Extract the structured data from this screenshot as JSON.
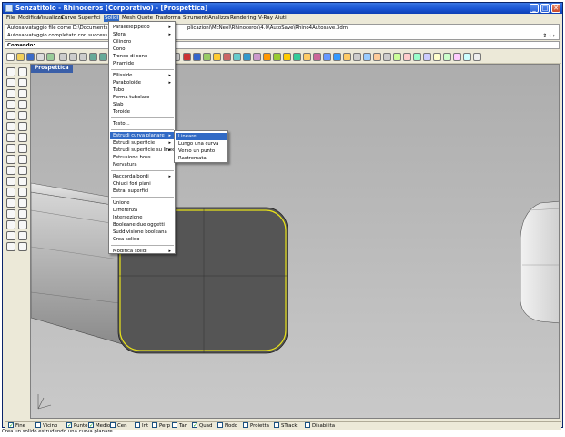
{
  "window": {
    "title": "Senzatitolo - Rhinoceros (Corporativo) - [Prospettica]",
    "controls": [
      "_",
      "□",
      "✕"
    ]
  },
  "menubar": [
    {
      "label": "File",
      "active": false
    },
    {
      "label": "Modifica",
      "active": false
    },
    {
      "label": "Visualizza",
      "active": false
    },
    {
      "label": "Curve",
      "active": false
    },
    {
      "label": "Superfici",
      "active": false
    },
    {
      "label": "Solidi",
      "active": true
    },
    {
      "label": "Mesh",
      "active": false
    },
    {
      "label": "Quote",
      "active": false
    },
    {
      "label": "Trasforma",
      "active": false
    },
    {
      "label": "Strumenti",
      "active": false
    },
    {
      "label": "Analizza",
      "active": false
    },
    {
      "label": "Rendering",
      "active": false
    },
    {
      "label": "V-Ray",
      "active": false
    },
    {
      "label": "Aiuti",
      "active": false
    }
  ],
  "command_history": [
    "Autosalvataggio file come D:\\Documents",
    "Autosalvataggio completato con success"
  ],
  "command_history_tail": "plicazioni\\McNeel\\Rhinoceros\\4.0\\AutoSave\\Rhino4Autosave.3dm",
  "command_prompt_label": "Comando:",
  "viewport_label": "Prospettica",
  "solidi_menu": {
    "items": [
      {
        "label": "Parallelepipedo",
        "submenu": true
      },
      {
        "label": "Sfera",
        "submenu": true
      },
      {
        "label": "Cilindro"
      },
      {
        "label": "Cono"
      },
      {
        "label": "Tronco di cono"
      },
      {
        "label": "Piramide"
      },
      {
        "sep": true
      },
      {
        "label": "Ellisside",
        "submenu": true
      },
      {
        "label": "Paraboloide",
        "submenu": true
      },
      {
        "label": "Tubo"
      },
      {
        "label": "Forma tubolare"
      },
      {
        "label": "Slab"
      },
      {
        "label": "Toroide"
      },
      {
        "sep": true
      },
      {
        "label": "Testo..."
      },
      {
        "sep": true
      },
      {
        "label": "Estrudi curva planare",
        "submenu": true,
        "highlighted": true
      },
      {
        "label": "Estrudi superficie",
        "submenu": true
      },
      {
        "label": "Estrudi superficie su linee",
        "submenu": true
      },
      {
        "label": "Estrusione boss"
      },
      {
        "label": "Nervatura"
      },
      {
        "sep": true
      },
      {
        "label": "Raccorda bordi",
        "submenu": true
      },
      {
        "label": "Chiudi fori piani"
      },
      {
        "label": "Estrai superfici"
      },
      {
        "sep": true
      },
      {
        "label": "Unione"
      },
      {
        "label": "Differenza"
      },
      {
        "label": "Intersezione"
      },
      {
        "label": "Booleane due oggetti"
      },
      {
        "label": "Suddivisione booleana"
      },
      {
        "label": "Crea solido"
      },
      {
        "sep": true
      },
      {
        "label": "Modifica solidi",
        "submenu": true
      }
    ]
  },
  "extrude_submenu": {
    "items": [
      {
        "label": "Lineare",
        "highlighted": true
      },
      {
        "label": "Lungo una curva"
      },
      {
        "label": "Verso un punto"
      },
      {
        "label": "Rastremata"
      }
    ]
  },
  "osnaps": [
    {
      "label": "Fine",
      "checked": true
    },
    {
      "label": "Vicino",
      "checked": false
    },
    {
      "label": "Punto",
      "checked": true
    },
    {
      "label": "Medio",
      "checked": true
    },
    {
      "label": "Cen",
      "checked": false
    },
    {
      "label": "Int",
      "checked": false
    },
    {
      "label": "Perp",
      "checked": false
    },
    {
      "label": "Tan",
      "checked": false
    },
    {
      "label": "Quad",
      "checked": true
    },
    {
      "label": "Nodo",
      "checked": false
    },
    {
      "label": "Proietta",
      "checked": false
    },
    {
      "label": "STrack",
      "checked": false
    },
    {
      "label": "Disabilita",
      "checked": false
    }
  ],
  "status_prompt": "Crea un solido estrudendo una curva planare",
  "colors": {
    "menu_highlight": "#316ac5",
    "titlebar": "#1a55d4",
    "viewport_bg": "#b8b8b8",
    "curve_selected": "#e8e21a"
  }
}
